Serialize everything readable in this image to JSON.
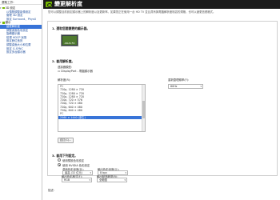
{
  "sidebar": {
    "header": "選取工作:",
    "items": [
      {
        "label": "3D 設定",
        "type": "cat"
      },
      {
        "label": "以預覽調整影像設定",
        "type": "link"
      },
      {
        "label": "管理 3D 設定",
        "type": "link"
      },
      {
        "label": "設定 Surround、PhysX",
        "type": "link"
      },
      {
        "label": "顯示",
        "type": "cat"
      },
      {
        "label": "變更解析度",
        "type": "sel"
      },
      {
        "label": "調整桌面色彩設定",
        "type": "link"
      },
      {
        "label": "旋轉顯示器",
        "type": "link"
      },
      {
        "label": "檢視 HDCP 狀態",
        "type": "link"
      },
      {
        "label": "設定數位音訊",
        "type": "link"
      },
      {
        "label": "調整桌面大小和位置",
        "type": "link"
      },
      {
        "label": "設定 G-SYNC",
        "type": "link"
      },
      {
        "label": "設定多台顯示器",
        "type": "link"
      }
    ]
  },
  "header": {
    "title": "變更解析度",
    "description": "您可以調整目前設定顯示器上的解析度以及更新率。如果您正在使用一台 HD TV 並且具有與電腦解析度相容的規格，也可以變更信號格式。"
  },
  "section1": {
    "title": "1. 選取您要變更的顯示器。",
    "monitor_label": "ASUS FX"
  },
  "section2": {
    "title": "2. 套用解析度。",
    "connector_label": "連接器類型:",
    "connector_value": "DisplayPort - 電腦顯示器",
    "resolution_label": "解析度(R):",
    "refresh_label": "重新整理頻率(F):",
    "refresh_value": "60Hz",
    "resolution_groups": [
      {
        "name": "PC",
        "items": [
          "720p, 1280 × 720",
          "720p, 1280 × 720",
          "720p, 1280 × 720",
          "720p, 720 × 576",
          "720p, 720 × 480",
          "720p, 640 × 480",
          "720p, 640 × 480"
        ]
      },
      {
        "name": "PC",
        "items": [
          "2560 × 1440 (原生)"
        ]
      }
    ],
    "selected_index": 7,
    "customize_button": "自訂(C)..."
  },
  "section3": {
    "title": "3. 套用下列設定。",
    "radio_default": "使用預設色彩設定",
    "radio_nvidia": "使用 NVIDIA 色彩設定",
    "desktop_color_depth_label": "桌面色彩深度(D):",
    "desktop_color_depth_value": "最高 (32 位元)",
    "output_color_depth_label": "輸出色彩深度(O):",
    "output_color_depth_value": "8 bpc",
    "output_color_format_label": "輸出色彩格式(F):",
    "output_color_format_value": "RGB",
    "output_dynamic_range_label": "輸出動態範圍(R):",
    "output_dynamic_range_value": "全範圍"
  },
  "footer": {
    "text": "描述:"
  }
}
